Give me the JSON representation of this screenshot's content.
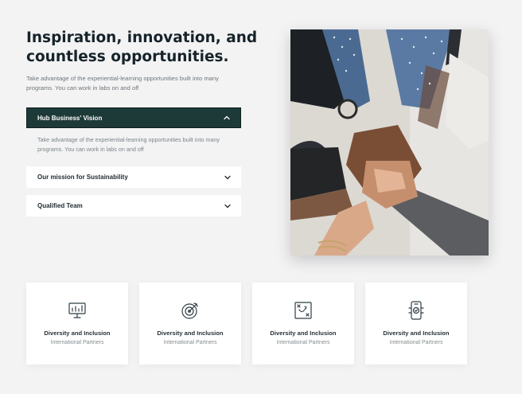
{
  "hero": {
    "title": "Inspiration, innovation, and countless opportunities.",
    "intro": "Take advantage of the experiential-learning opportunities built into many programs. You can work in labs on and off"
  },
  "accordion": {
    "open": {
      "label": "Hub Business' Vision",
      "body": "Take advantage of the experiential-learning opportunities built into many programs. You can work in labs on and off",
      "icon": "chevron-up-icon"
    },
    "items": [
      {
        "label": "Our mission for Sustainability",
        "icon": "chevron-down-icon"
      },
      {
        "label": "Qualified Team",
        "icon": "chevron-down-icon"
      }
    ]
  },
  "photo": {
    "subject": "team-hands-stack-photo"
  },
  "cards": [
    {
      "icon": "presentation-chart-icon",
      "title": "Diversity and Inclusion",
      "subtitle": "International Partners"
    },
    {
      "icon": "target-arrow-icon",
      "title": "Diversity and Inclusion",
      "subtitle": "International Partners"
    },
    {
      "icon": "strategy-board-icon",
      "title": "Diversity and Inclusion",
      "subtitle": "International Partners"
    },
    {
      "icon": "phone-check-icon",
      "title": "Diversity and Inclusion",
      "subtitle": "International Partners"
    }
  ],
  "colors": {
    "background": "#f3f3f4",
    "accent_dark_green": "#1d3a38",
    "heading": "#16232a",
    "body_text": "#6e767b",
    "card_bg": "#ffffff"
  }
}
